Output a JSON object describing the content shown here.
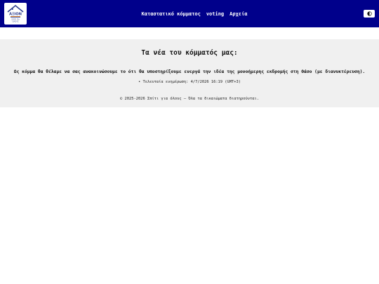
{
  "header": {
    "logo": {
      "brand": "ΑΞΙΟΝ",
      "tagline_line1": "ΣΠΙΤΙ ΓΙΑ",
      "tagline_line2": "ΟΛΟΥΣ",
      "colors": {
        "house": "#2f3f8f",
        "stripe_orange": "#e07b1a",
        "stripe_blue": "#2f3f8f"
      }
    },
    "nav": [
      {
        "label": "Καταστατικό κόμματος"
      },
      {
        "label": "voting"
      },
      {
        "label": "Αρχεία"
      }
    ],
    "theme_toggle_icon": "half-moon-icon",
    "background": "#00008b"
  },
  "main": {
    "title": "Τα νέα του κόμματός μας:",
    "announcement": "Ως κόμμα θα θέλαμε να σας ανακοινώσουμε το ότι θα υποστηρίξουμε ενεργά την ιδέα της μονοήμερης εκδρομής στη Θάσο (με διανυκτέρευση).",
    "updated": "• Τελευταία ενημέρωση: 4/7/2026 16:19 (GMT+3)",
    "footer": "© 2025-2026 Σπίτι για όλους — Όλα τα δικαιώματα διατηρούνται.",
    "background": "#f0f0f0"
  }
}
